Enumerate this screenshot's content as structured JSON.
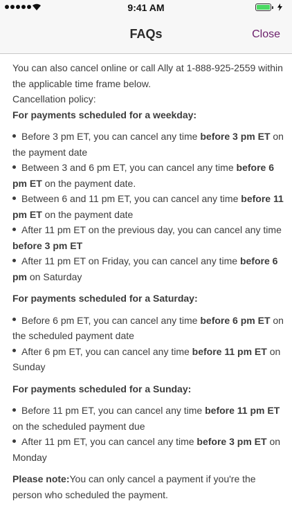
{
  "status_bar": {
    "time": "9:41 AM"
  },
  "nav": {
    "title": "FAQs",
    "close_label": "Close"
  },
  "intro": {
    "line1": "You can also cancel online or call Ally at 1-888-925-2559 within the applicable time frame below.",
    "policy_label": "Cancellation policy:"
  },
  "sections": [
    {
      "heading": "For payments scheduled for a weekday:",
      "items": [
        {
          "pre": "Before 3 pm ET, you can cancel any time ",
          "bold": "before 3 pm ET",
          "post": " on the payment date"
        },
        {
          "pre": "Between 3 and 6 pm ET, you can cancel any time ",
          "bold": "before 6 pm ET",
          "post": " on the payment date."
        },
        {
          "pre": "Between 6 and 11 pm ET, you can cancel any time ",
          "bold": "before 11 pm ET",
          "post": " on the payment date"
        },
        {
          "pre": "After 11 pm ET on the previous day, you can cancel any time ",
          "bold": "before 3 pm ET",
          "post": ""
        },
        {
          "pre": "After 11 pm ET on Friday, you can cancel any time ",
          "bold": "before 6 pm",
          "post": " on Saturday"
        }
      ]
    },
    {
      "heading": "For payments scheduled for a Saturday:",
      "items": [
        {
          "pre": "Before 6 pm ET, you can cancel any time ",
          "bold": "before 6 pm ET",
          "post": " on the scheduled payment date"
        },
        {
          "pre": "After 6 pm ET, you can cancel any time ",
          "bold": "before 11 pm ET",
          "post": " on Sunday"
        }
      ]
    },
    {
      "heading": "For payments scheduled for a Sunday:",
      "items": [
        {
          "pre": "Before 11 pm ET, you can cancel any time ",
          "bold": "before 11 pm ET",
          "post": " on the scheduled payment due"
        },
        {
          "pre": "After 11 pm ET, you can cancel any time ",
          "bold": "before 3 pm ET",
          "post": " on Monday"
        }
      ]
    }
  ],
  "note": {
    "label": "Please note:",
    "text": "You can only cancel a payment if you're the person who scheduled the payment."
  }
}
